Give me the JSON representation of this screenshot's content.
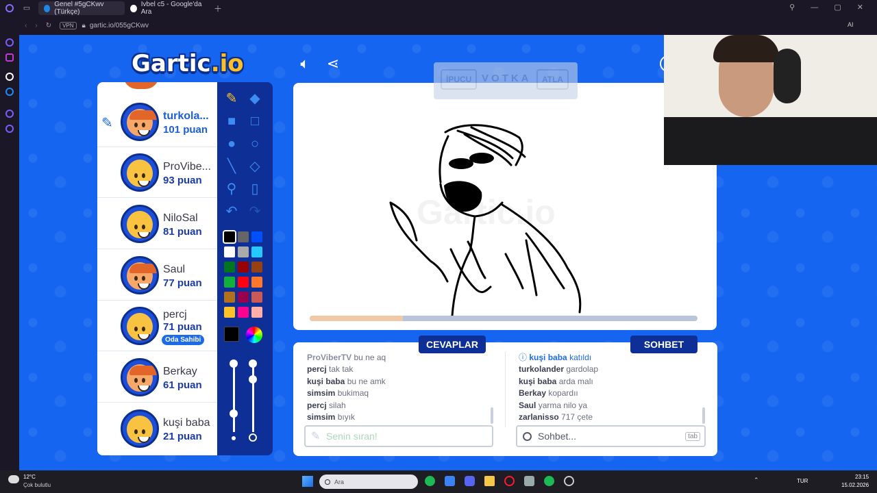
{
  "browser": {
    "tabs": [
      {
        "label": "Genel #5gCKwv (Türkçe)",
        "active": true
      },
      {
        "label": "Ivbel c5 - Google'da Ara",
        "active": false
      }
    ],
    "vpn_label": "VPN",
    "url": "gartic.io/055gCKwv",
    "ai_label": "AI"
  },
  "game": {
    "logo_main": "Gartic",
    "logo_suffix": ".io",
    "players": [
      {
        "name": "turkola...",
        "score": "101 puan",
        "active": true,
        "avatar": "red"
      },
      {
        "name": "ProVibe...",
        "score": "93 puan",
        "active": false,
        "avatar": "default"
      },
      {
        "name": "NiloSal",
        "score": "81 puan",
        "active": false,
        "avatar": "default"
      },
      {
        "name": "Saul",
        "score": "77 puan",
        "active": false,
        "avatar": "red"
      },
      {
        "name": "percj",
        "score": "71 puan",
        "active": false,
        "avatar": "default",
        "badge": "Oda Sahibi"
      },
      {
        "name": "Berkay",
        "score": "61 puan",
        "active": false,
        "avatar": "red"
      },
      {
        "name": "kuşi baba",
        "score": "21 puan",
        "active": false,
        "avatar": "default"
      }
    ],
    "palette": [
      "#000000",
      "#666666",
      "#0050ff",
      "#ffffff",
      "#aaaaaa",
      "#26c9ff",
      "#017420",
      "#990000",
      "#964112",
      "#11b03c",
      "#ff0013",
      "#ff7829",
      "#b0701c",
      "#99004e",
      "#cb5a57",
      "#ffc126",
      "#ff008f",
      "#feafa8"
    ],
    "hint": {
      "word": "VOTKA",
      "left_btn": "İPUCU",
      "right_btn": "ATLA"
    },
    "watermark": "Gartic.io",
    "progress": 0.24,
    "answers": {
      "tab_label": "CEVAPLAR",
      "messages": [
        {
          "user": "ProViberTV",
          "text": "bu ne aq"
        },
        {
          "user": "percj",
          "text": "tak tak"
        },
        {
          "user": "kuşi baba",
          "text": "bu ne amk"
        },
        {
          "user": "simsim",
          "text": "bukimaq"
        },
        {
          "user": "percj",
          "text": "silah"
        },
        {
          "user": "simsim",
          "text": "bıyık"
        }
      ],
      "input_placeholder": "Senin sıran!"
    },
    "chat": {
      "tab_label": "SOHBET",
      "system_message": {
        "user": "kuşi baba",
        "text": "katıldı"
      },
      "messages": [
        {
          "user": "turkolander",
          "text": "gardolap"
        },
        {
          "user": "kuşi baba",
          "text": "arda malı"
        },
        {
          "user": "Berkay",
          "text": "kopardıı"
        },
        {
          "user": "Saul",
          "text": "yarma nilo ya"
        },
        {
          "user": "zarlanisso",
          "text": "717 çete"
        }
      ],
      "input_placeholder": "Sohbet...",
      "tab_hint": "tab"
    }
  },
  "taskbar": {
    "weather_temp": "12°C",
    "weather_desc": "Çok bulutlu",
    "search_placeholder": "Ara",
    "language": "TUR",
    "time": "23:15",
    "date": "15.02.2026"
  }
}
